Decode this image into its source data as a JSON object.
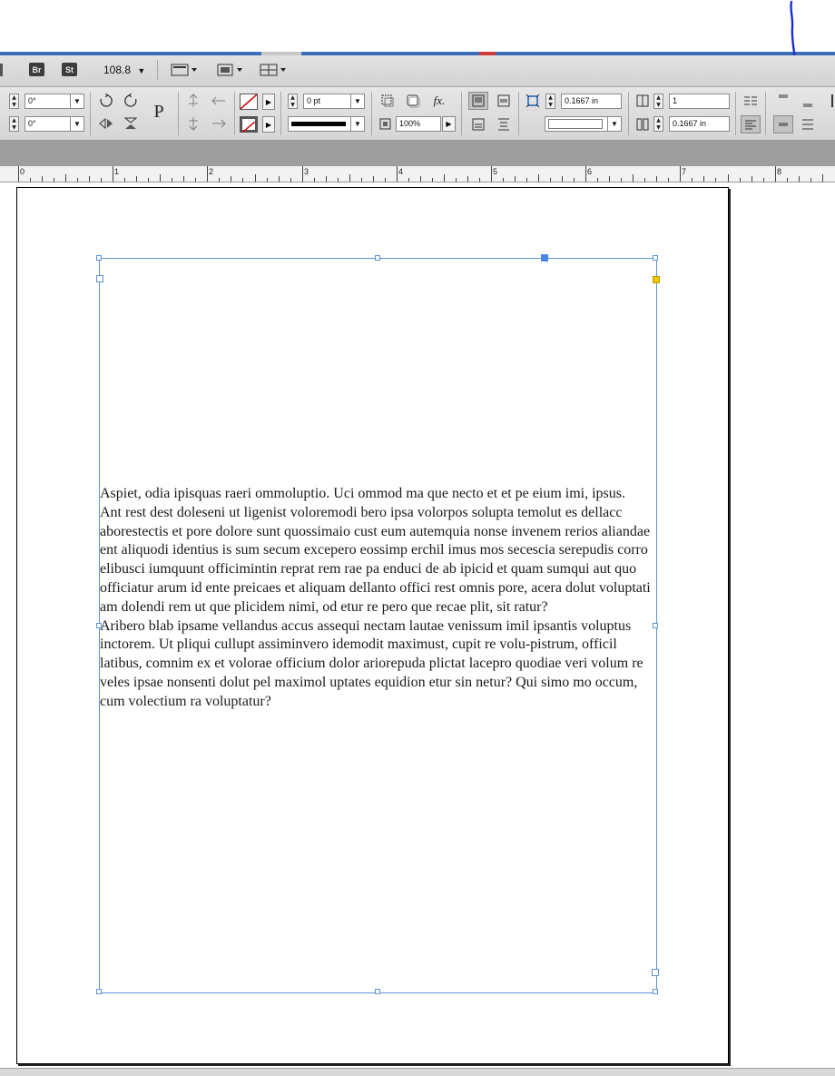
{
  "menubar": {
    "bridge_label": "Br",
    "stock_label": "St",
    "zoom_value": "108.8",
    "zoom_arrow": "▼"
  },
  "controls": {
    "rotate_angle": "0°",
    "shear_angle": "0°",
    "stroke_weight": "0 pt",
    "opacity": "100%",
    "inset_top": "0.1667 in",
    "inset_bottom": "0.1667 in",
    "columns": "1",
    "reference_point_label": "P",
    "fx_label": "fx."
  },
  "ruler": {
    "labels": [
      "0",
      "1",
      "2",
      "3",
      "4",
      "5",
      "6",
      "7",
      "8"
    ]
  },
  "document": {
    "paragraphs": [
      "Aspiet, odia ipisquas raeri ommoluptio. Uci ommod ma que necto et et pe eium imi, ipsus.",
      "Ant rest dest doleseni ut ligenist voloremodi bero ipsa volorpos solupta temolut es dellacc aborestectis et pore dolore sunt quossimaio cust eum autemquia nonse invenem rerios aliandae ent aliquodi identius is sum secum excepero eossimp erchil imus mos secescia serepudis corro elibusci iumquunt officimintin reprat rem rae pa enduci de ab ipicid et quam sumqui aut quo officiatur arum id ente preicaes et aliquam dellanto offici rest omnis pore, acera dolut voluptati am dolendi rem ut que plicidem nimi, od etur re pero que recae plit, sit ratur?",
      "Aribero blab ipsame vellandus accus assequi nectam lautae venissum imil ipsantis voluptus inctorem. Ut pliqui cullupt assiminvero idemodit maximust, cupit re volu-pistrum, officil latibus, comnim ex et volorae officium dolor ariorepuda plictat lacepro quodiae veri volum re veles ipsae nonsenti dolut pel maximol uptates equidion etur sin netur? Qui simo mo occum, cum volectium ra voluptatur?"
    ]
  },
  "colors": {
    "frame_blue": "#5b93d6",
    "annotation_blue": "#1a2fd0",
    "corner_yellow": "#f2c800"
  }
}
